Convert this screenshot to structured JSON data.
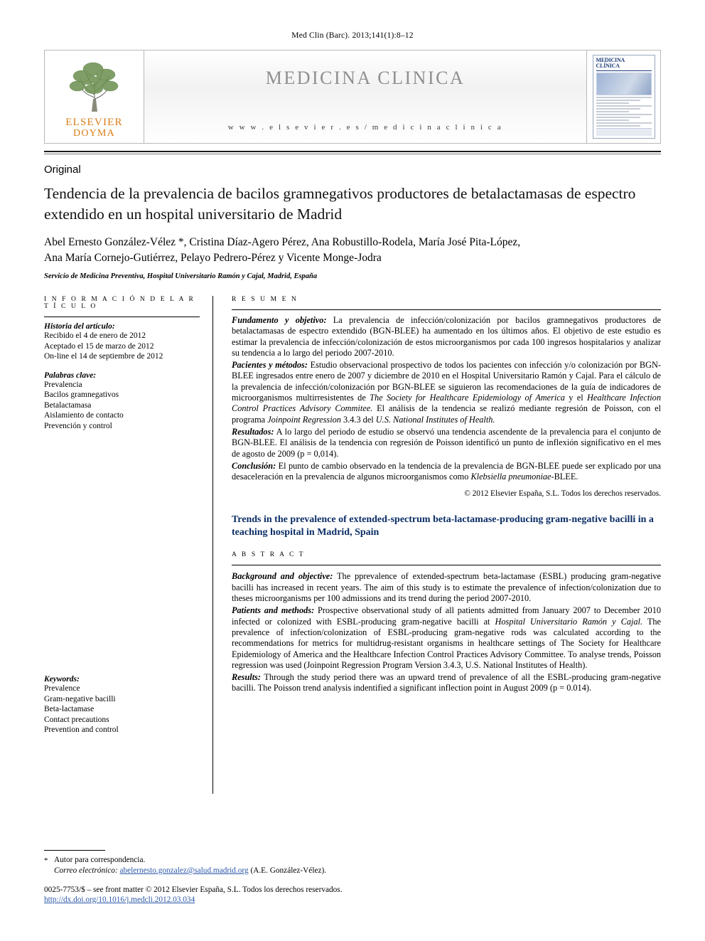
{
  "header": {
    "journal_citation": "Med Clin (Barc). 2013;141(1):8–12"
  },
  "masthead": {
    "publisher_primary": "ELSEVIER",
    "publisher_secondary": "DOYMA",
    "journal_title": "MEDICINA CLINICA",
    "journal_url": "w w w . e l s e v i e r . e s / m e d i c i n a c l i n i c a",
    "cover": {
      "line1": "MEDICINA",
      "line2": "CLÍNICA"
    }
  },
  "article": {
    "kicker": "Original",
    "title": "Tendencia de la prevalencia de bacilos gramnegativos productores de betalactamasas de espectro extendido en un hospital universitario de Madrid",
    "authors_line1": "Abel Ernesto González-Vélez *, Cristina Díaz-Agero Pérez, Ana Robustillo-Rodela, María José Pita-López,",
    "authors_line2": "Ana María Cornejo-Gutiérrez, Pelayo Pedrero-Pérez y Vicente Monge-Jodra",
    "affiliation": "Servicio de Medicina Preventiva, Hospital Universitario Ramón y Cajal, Madrid, España"
  },
  "info": {
    "section_head": "I N F O R M A C I Ó N   D E L   A R T Í C U L O",
    "history_title": "Historia del artículo:",
    "history": [
      "Recibido el 4 de enero de 2012",
      "Aceptado el 15 de marzo de 2012",
      "On-line el 14 de septiembre de 2012"
    ],
    "keywords_title": "Palabras clave:",
    "keywords": [
      "Prevalencia",
      "Bacilos gramnegativos",
      "Betalactamasa",
      "Aislamiento de contacto",
      "Prevención y control"
    ],
    "keywords_en_title": "Keywords:",
    "keywords_en": [
      "Prevalence",
      "Gram-negative bacilli",
      "Beta-lactamase",
      "Contact precautions",
      "Prevention and control"
    ]
  },
  "resumen": {
    "head": "R E S U M E N",
    "p1_lead": "Fundamento y objetivo:",
    "p1": " La prevalencia de infección/colonización por bacilos gramnegativos productores de betalactamasas de espectro extendido (BGN-BLEE) ha aumentado en los últimos años. El objetivo de este estudio es estimar la prevalencia de infección/colonización de estos microorganismos por cada 100 ingresos hospitalarios y analizar su tendencia a lo largo del periodo 2007-2010.",
    "p2_lead": "Pacientes y métodos:",
    "p2_a": " Estudio observacional prospectivo de todos los pacientes con infección y/o colonización por BGN-BLEE ingresados entre enero de 2007 y diciembre de 2010 en el Hospital Universitario Ramón y Cajal. Para el cálculo de la prevalencia de infección/colonización por BGN-BLEE se siguieron las recomendaciones de la guía de indicadores de microorganismos multirresistentes de ",
    "p2_i1": "The Society for Healthcare Epidemiology of America",
    "p2_b": " y el ",
    "p2_i2": "Healthcare Infection Control Practices Advisory Commitee.",
    "p2_c": " El análisis de la tendencia se realizó mediante regresión de Poisson, con el programa ",
    "p2_i3": "Joinpoint Regression",
    "p2_d": " 3.4.3 del ",
    "p2_i4": "U.S. National Institutes of Health.",
    "p3_lead": "Resultados:",
    "p3": " A lo largo del periodo de estudio se observó una tendencia ascendente de la prevalencia para el conjunto de BGN-BLEE. El análisis de la tendencia con regresión de Poisson identificó un punto de inflexión significativo en el mes de agosto de 2009 (p = 0,014).",
    "p4_lead": "Conclusión:",
    "p4_a": " El punto de cambio observado en la tendencia de la prevalencia de BGN-BLEE puede ser explicado por una desaceleración en la prevalencia de algunos microorganismos como ",
    "p4_i1": "Klebsiella pneumoniae",
    "p4_b": "-BLEE.",
    "copyright": "© 2012 Elsevier España, S.L. Todos los derechos reservados."
  },
  "english": {
    "title": "Trends in the prevalence of extended-spectrum beta-lactamase-producing gram-negative bacilli in a teaching hospital in Madrid, Spain",
    "head": "A B S T R A C T",
    "p1_lead": "Background and objective:",
    "p1": " The pprevalence of extended-spectrum beta-lactamase (ESBL) producing gram-negative bacilli has increased in recent years. The aim of this study is to estimate the prevalence of infection/colonization due to theses microorganisms per 100 admissions and its trend during the period 2007-2010.",
    "p2_lead": "Patients and methods:",
    "p2_a": " Prospective observational study of all patients admitted from January 2007 to December 2010 infected or colonized with ESBL-producing gram-negative bacilli at ",
    "p2_i1": "Hospital Universitario Ramón y Cajal.",
    "p2_b": " The prevalence of infection/colonization of ESBL-producing gram-negative rods was calculated according to the recommendations for metrics for multidrug-resistant organisms in healthcare settings of The Society for Healthcare Epidemiology of America and the Healthcare Infection Control Practices Advisory Committee. To analyse trends, Poisson regression was used (Joinpoint Regression Program Version 3.4.3, U.S. National Institutes of Health).",
    "p3_lead": "Results:",
    "p3": " Through the study period there was an upward trend of prevalence of all the ESBL-producing gram-negative bacilli. The Poisson trend analysis indentified a significant inflection point in August 2009 (p = 0.014)."
  },
  "footer": {
    "corresponding_star": "*",
    "corresponding_label": "Autor para correspondencia.",
    "email_label": "Correo electrónico:",
    "email": "abelernesto.gonzalez@salud.madrid.org",
    "email_owner": "(A.E. González-Vélez).",
    "issn_line": "0025-7753/$ – see front matter © 2012 Elsevier España, S.L. Todos los derechos reservados.",
    "doi": "http://dx.doi.org/10.1016/j.medcli.2012.03.034"
  }
}
